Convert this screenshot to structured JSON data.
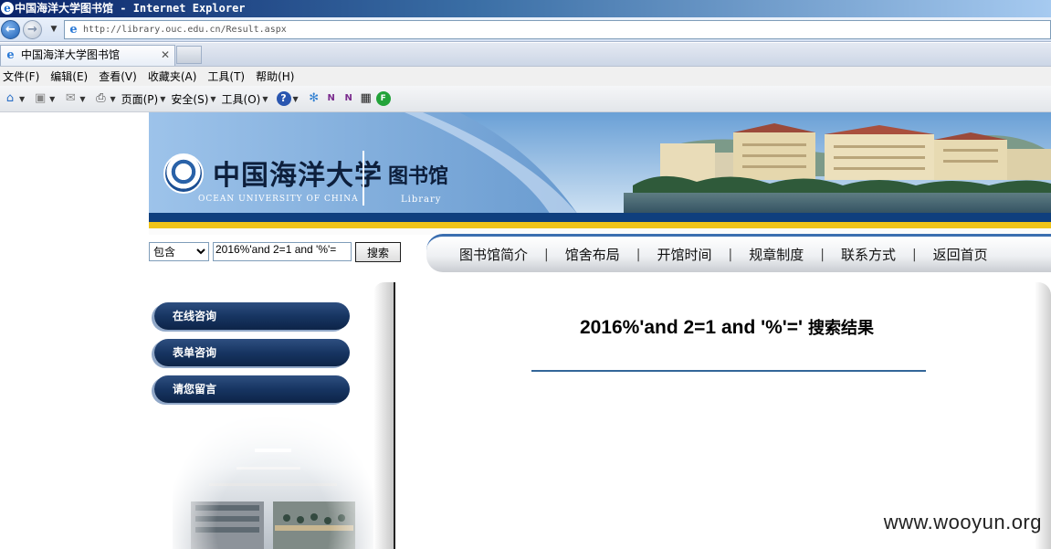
{
  "window": {
    "title": "中国海洋大学图书馆",
    "title_separator": " - ",
    "app_name": "Internet Explorer"
  },
  "address_bar": {
    "url": "http://library.ouc.edu.cn/Result.aspx"
  },
  "tabs": [
    {
      "label": "中国海洋大学图书馆",
      "active": true
    }
  ],
  "menu": {
    "items": [
      "文件(F)",
      "编辑(E)",
      "查看(V)",
      "收藏夹(A)",
      "工具(T)",
      "帮助(H)"
    ]
  },
  "command_bar": {
    "page_label": "页面(P)",
    "safety_label": "安全(S)",
    "tools_label": "工具(O)"
  },
  "site": {
    "banner": {
      "name_cn": "中国海洋大学",
      "name_en": "OCEAN UNIVERSITY OF CHINA",
      "library_cn": "图书馆",
      "library_en": "Library"
    },
    "search": {
      "scope": "包含",
      "query": "2016%'and 2=1 and '%'=",
      "button": "搜索"
    },
    "nav": [
      "图书馆简介",
      "馆舍布局",
      "开馆时间",
      "规章制度",
      "联系方式",
      "返回首页"
    ],
    "sidebar": [
      "在线咨询",
      "表单咨询",
      "请您留言"
    ],
    "result": {
      "query": "2016%'and 2=1 and '%'='",
      "suffix": "搜索结果"
    }
  },
  "watermark": "www.wooyun.org",
  "colors": {
    "title_bar": "#0a246a",
    "banner_sky": "#6c9dd1",
    "banner_stripe_gold": "#f0c419",
    "banner_stripe_navy": "#0f3f7e",
    "sidebar_button": "#173562",
    "result_rule": "#336699"
  }
}
